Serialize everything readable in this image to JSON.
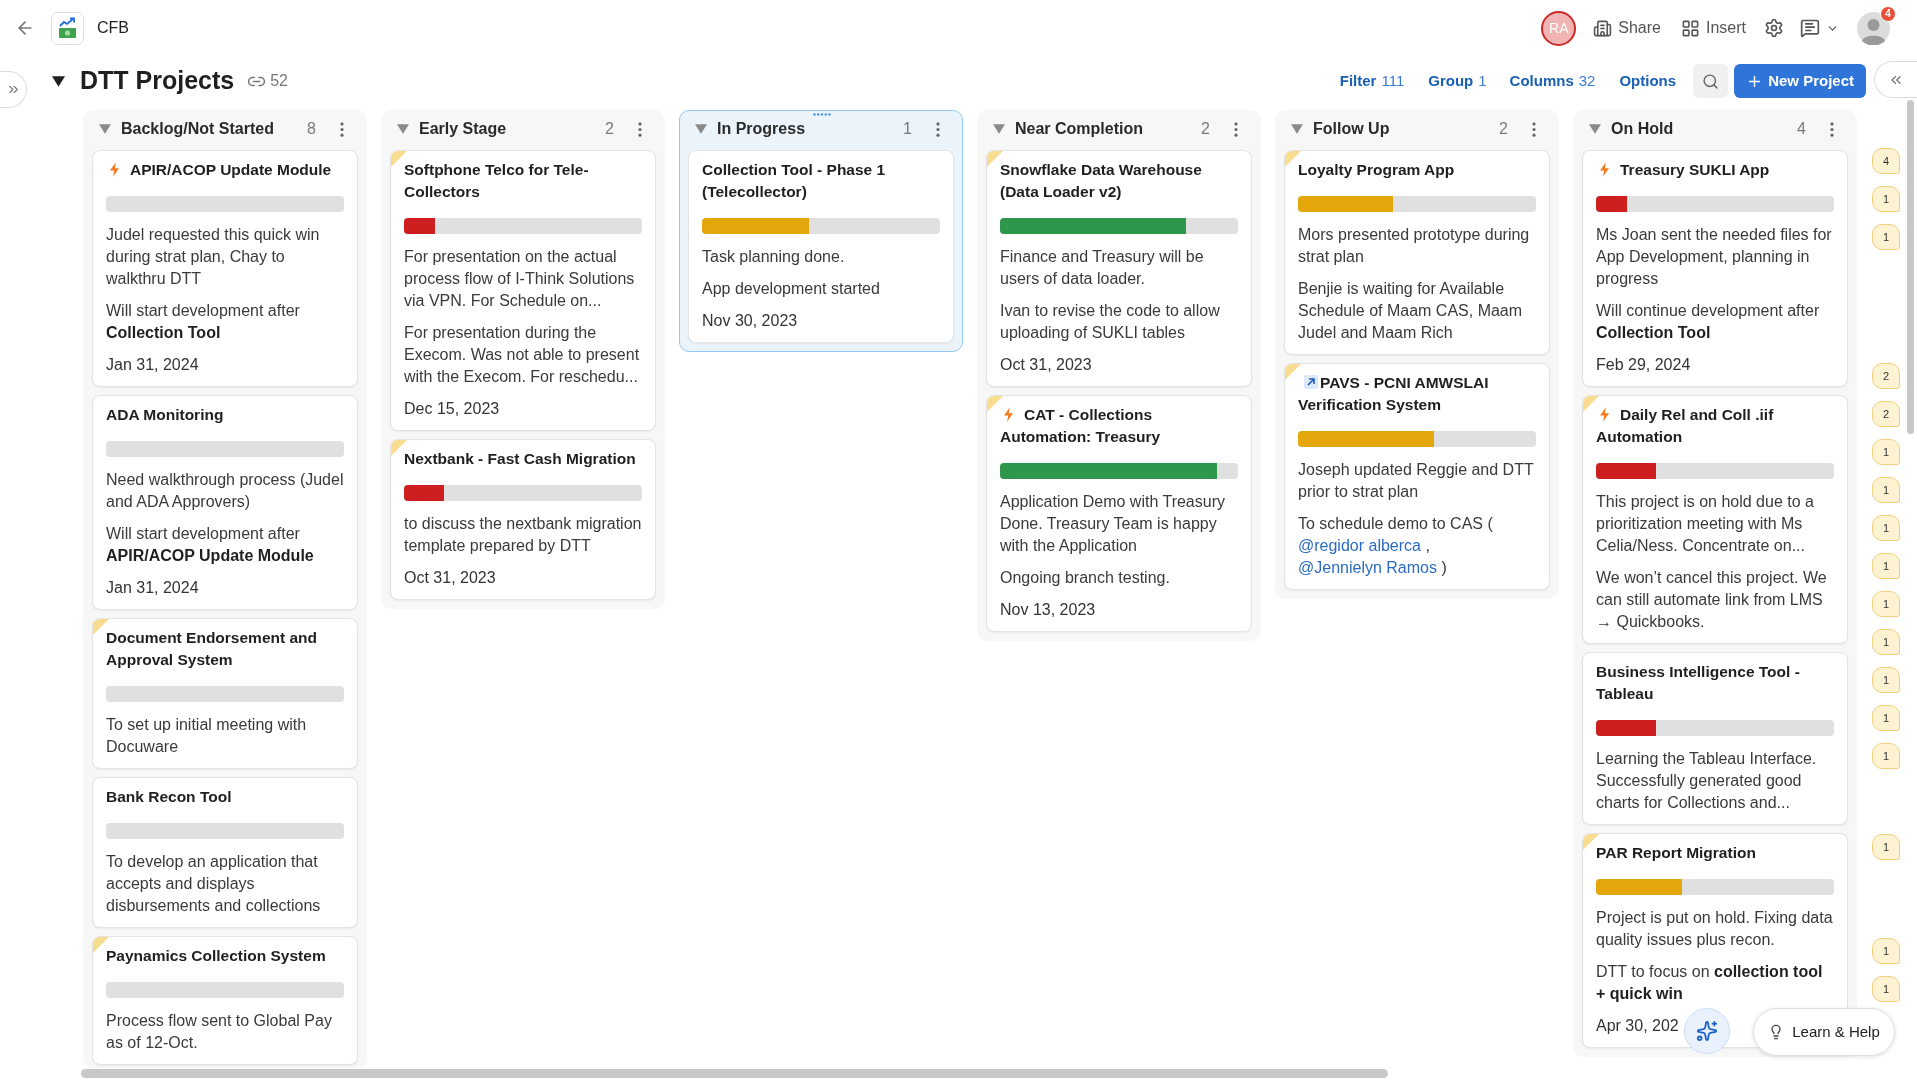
{
  "top_bar": {
    "title": "CFB",
    "collaborator": "RA",
    "actions": [
      {
        "label": "Share"
      },
      {
        "label": "Insert"
      }
    ],
    "notifications": "4"
  },
  "page": {
    "title": "DTT Projects",
    "expanded": true,
    "link_count": "52"
  },
  "toolbar": [
    {
      "label": "Filter",
      "count": "111"
    },
    {
      "label": "Group",
      "count": "1"
    },
    {
      "label": "Columns",
      "count": "32"
    },
    {
      "label": "Options"
    }
  ],
  "new_button": {
    "label": "New Project"
  },
  "columns": [
    {
      "title": "Backlog/Not Started",
      "count": "8",
      "expanded": true,
      "selected": false,
      "cards": [
        {
          "title": "APIR/ACOP Update Module",
          "flagged": false,
          "urgent": true,
          "linked": false,
          "notes": [
            {
              "kind": "text",
              "text": "Judel requested this quick win during strat plan, Chay to walkthru DTT"
            },
            {
              "kind": "text",
              "text": "Will start development after **Collection Tool**"
            }
          ],
          "date": "Jan 31, 2024"
        },
        {
          "title": "ADA Monitoring",
          "flagged": false,
          "urgent": false,
          "linked": false,
          "notes": [
            {
              "kind": "text",
              "text": "Need walkthrough process (Judel and ADA Approvers)"
            },
            {
              "kind": "text",
              "text": "Will start development after **APIR/ACOP Update Module**"
            }
          ],
          "date": "Jan 31, 2024"
        },
        {
          "title": "Document Endorsement and Approval System",
          "flagged": true,
          "urgent": false,
          "linked": false,
          "notes": [
            {
              "kind": "text",
              "text": "To set up initial meeting with Docuware"
            }
          ]
        },
        {
          "title": "Bank Recon Tool",
          "flagged": false,
          "urgent": false,
          "linked": false,
          "notes": [
            {
              "kind": "text",
              "text": "To develop an application that accepts and displays disbursements and collections"
            }
          ]
        },
        {
          "title": "Paynamics Collection System",
          "flagged": true,
          "urgent": false,
          "linked": false,
          "notes": [
            {
              "kind": "text",
              "text": "Process flow sent to Global Pay as of 12-Oct."
            }
          ]
        }
      ]
    },
    {
      "title": "Early Stage",
      "count": "2",
      "expanded": true,
      "selected": false,
      "cards": [
        {
          "title": "Softphone Telco for Tele-Collectors",
          "flagged": true,
          "urgent": false,
          "linked": false,
          "level": 0.13,
          "notes": [
            {
              "kind": "text",
              "text": "For presentation on the actual process flow of I-Think Solutions via VPN. For Schedule on..."
            },
            {
              "kind": "text",
              "text": "For presentation during the Execom. Was not able to present with the Execom. For reschedu..."
            }
          ],
          "date": "Dec 15, 2023"
        },
        {
          "title": "Nextbank - Fast Cash Migration",
          "flagged": true,
          "urgent": false,
          "linked": false,
          "level": 0.17,
          "notes": [
            {
              "kind": "text",
              "text": "to discuss the nextbank migration template prepared by DTT"
            }
          ],
          "date": "Oct 31, 2023"
        }
      ]
    },
    {
      "title": "In Progress",
      "count": "1",
      "expanded": true,
      "selected": true,
      "cards": [
        {
          "title": "Collection Tool - Phase 1 (Telecollector)",
          "flagged": false,
          "urgent": false,
          "linked": false,
          "level": 0.45,
          "notes": [
            {
              "kind": "text",
              "text": "Task planning done."
            },
            {
              "kind": "text",
              "text": "App development started"
            }
          ],
          "date": "Nov 30, 2023"
        }
      ]
    },
    {
      "title": "Near Completion",
      "count": "2",
      "expanded": true,
      "selected": false,
      "cards": [
        {
          "title": "Snowflake Data Warehouse (Data Loader v2)",
          "flagged": true,
          "urgent": false,
          "linked": false,
          "level": 0.78,
          "notes": [
            {
              "kind": "text",
              "text": "Finance and Treasury will be users of data loader."
            },
            {
              "kind": "text",
              "text": "Ivan to revise the code to allow uploading of SUKLI tables"
            }
          ],
          "date": "Oct 31, 2023"
        },
        {
          "title": "CAT - Collections Automation: Treasury",
          "flagged": true,
          "urgent": true,
          "linked": false,
          "level": 0.91,
          "notes": [
            {
              "kind": "text",
              "text": "Application Demo with Treasury Done. Treasury Team is happy with the Application"
            },
            {
              "kind": "text",
              "text": "Ongoing branch testing."
            }
          ],
          "date": "Nov 13, 2023"
        }
      ]
    },
    {
      "title": "Follow Up",
      "count": "2",
      "expanded": true,
      "selected": false,
      "cards": [
        {
          "title": "Loyalty Program App",
          "flagged": true,
          "urgent": false,
          "linked": false,
          "level": 0.4,
          "notes": [
            {
              "kind": "text",
              "text": "Mors presented prototype during strat plan"
            },
            {
              "kind": "text",
              "text": "Benjie is waiting for Available Schedule of Maam CAS, Maam Judel and Maam Rich"
            }
          ]
        },
        {
          "title": "PAVS - PCNI AMWSLAI Verification System",
          "flagged": true,
          "urgent": false,
          "linked": true,
          "level": 0.57,
          "notes": [
            {
              "kind": "text",
              "text": "Joseph updated Reggie and DTT prior to strat plan"
            },
            {
              "kind": "mentions",
              "parts": [
                {
                  "kind": "text",
                  "text": "To schedule demo to CAS ("
                },
                {
                  "kind": "mention",
                  "text": "@regidor alberca"
                },
                {
                  "kind": "text",
                  "text": ","
                },
                {
                  "kind": "mention",
                  "text": "@Jennielyn Ramos"
                },
                {
                  "kind": "text",
                  "text": ")"
                }
              ]
            }
          ]
        }
      ]
    },
    {
      "title": "On Hold",
      "count": "4",
      "expanded": true,
      "selected": false,
      "cards": [
        {
          "title": "Treasury SUKLI App",
          "flagged": false,
          "urgent": true,
          "linked": false,
          "level": 0.13,
          "notes": [
            {
              "kind": "text",
              "text": "Ms Joan sent the needed files for App Development, planning in progress"
            },
            {
              "kind": "text",
              "text": "Will continue development after **Collection Tool**"
            }
          ],
          "date": "Feb 29, 2024"
        },
        {
          "title": "Daily Rel and Coll .iif Automation",
          "flagged": true,
          "urgent": true,
          "linked": false,
          "level": 0.25,
          "notes": [
            {
              "kind": "text",
              "text": "This project is on hold due to a prioritization meeting with Ms Celia/Ness. Concentrate on..."
            },
            {
              "kind": "text",
              "text": "We won’t cancel this project. We can still automate link from LMS → Quickbooks."
            }
          ]
        },
        {
          "title": "Business Intelligence Tool - Tableau",
          "flagged": false,
          "urgent": false,
          "linked": false,
          "level": 0.25,
          "notes": [
            {
              "kind": "text",
              "text": "Learning the Tableau Interface. Successfully generated good charts for Collections and..."
            }
          ]
        },
        {
          "title": "PAR Report Migration",
          "flagged": true,
          "urgent": false,
          "linked": false,
          "level": 0.36,
          "notes": [
            {
              "kind": "text",
              "text": "Project is put on hold. Fixing data quality issues plus recon."
            },
            {
              "kind": "text",
              "text": "DTT to focus on **collection tool + quick win**"
            }
          ],
          "date": "Apr 30, 202"
        }
      ]
    }
  ],
  "comment_badges": [
    [
      "4",
      "1",
      "1"
    ],
    [
      "2",
      "2",
      "1",
      "1",
      "1",
      "1",
      "1",
      "1",
      "1",
      "1",
      "1"
    ],
    [
      "1"
    ],
    [
      "1",
      "1"
    ]
  ],
  "help_button": {
    "label": "Learn & Help"
  }
}
